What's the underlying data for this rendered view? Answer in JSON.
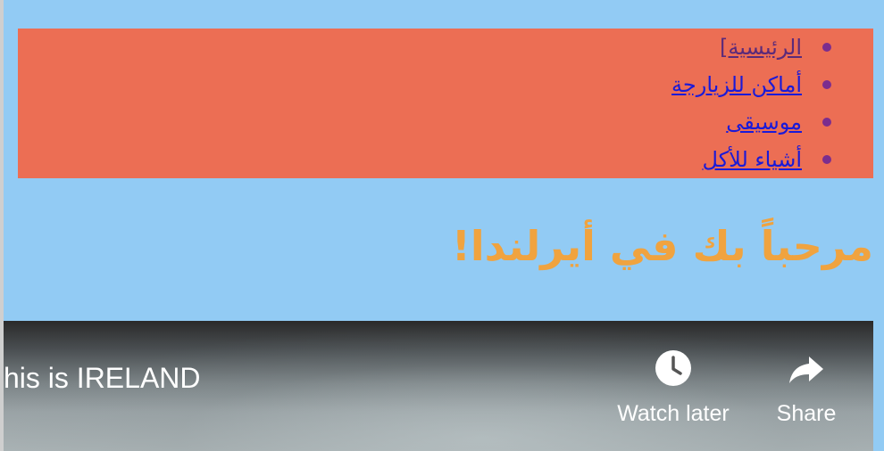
{
  "nav": {
    "items": [
      {
        "label": "الرئيسية]",
        "state": "visited"
      },
      {
        "label": "أماكن للزيارجة",
        "state": "link"
      },
      {
        "label": "موسيقى",
        "state": "link"
      },
      {
        "label": "أشياء للأكل",
        "state": "link"
      }
    ]
  },
  "heading": "مرحباً بك في أيرلندا!",
  "video": {
    "title": "his is IRELAND",
    "watch_later_label": "Watch later",
    "share_label": "Share",
    "watch_later_icon": "clock-icon",
    "share_icon": "share-arrow-icon"
  },
  "colors": {
    "page_background": "#92cbf4",
    "nav_background": "#ec6e54",
    "heading": "#f0a33f",
    "link": "#1a1ad8",
    "visited_link": "#5b2a7a"
  }
}
